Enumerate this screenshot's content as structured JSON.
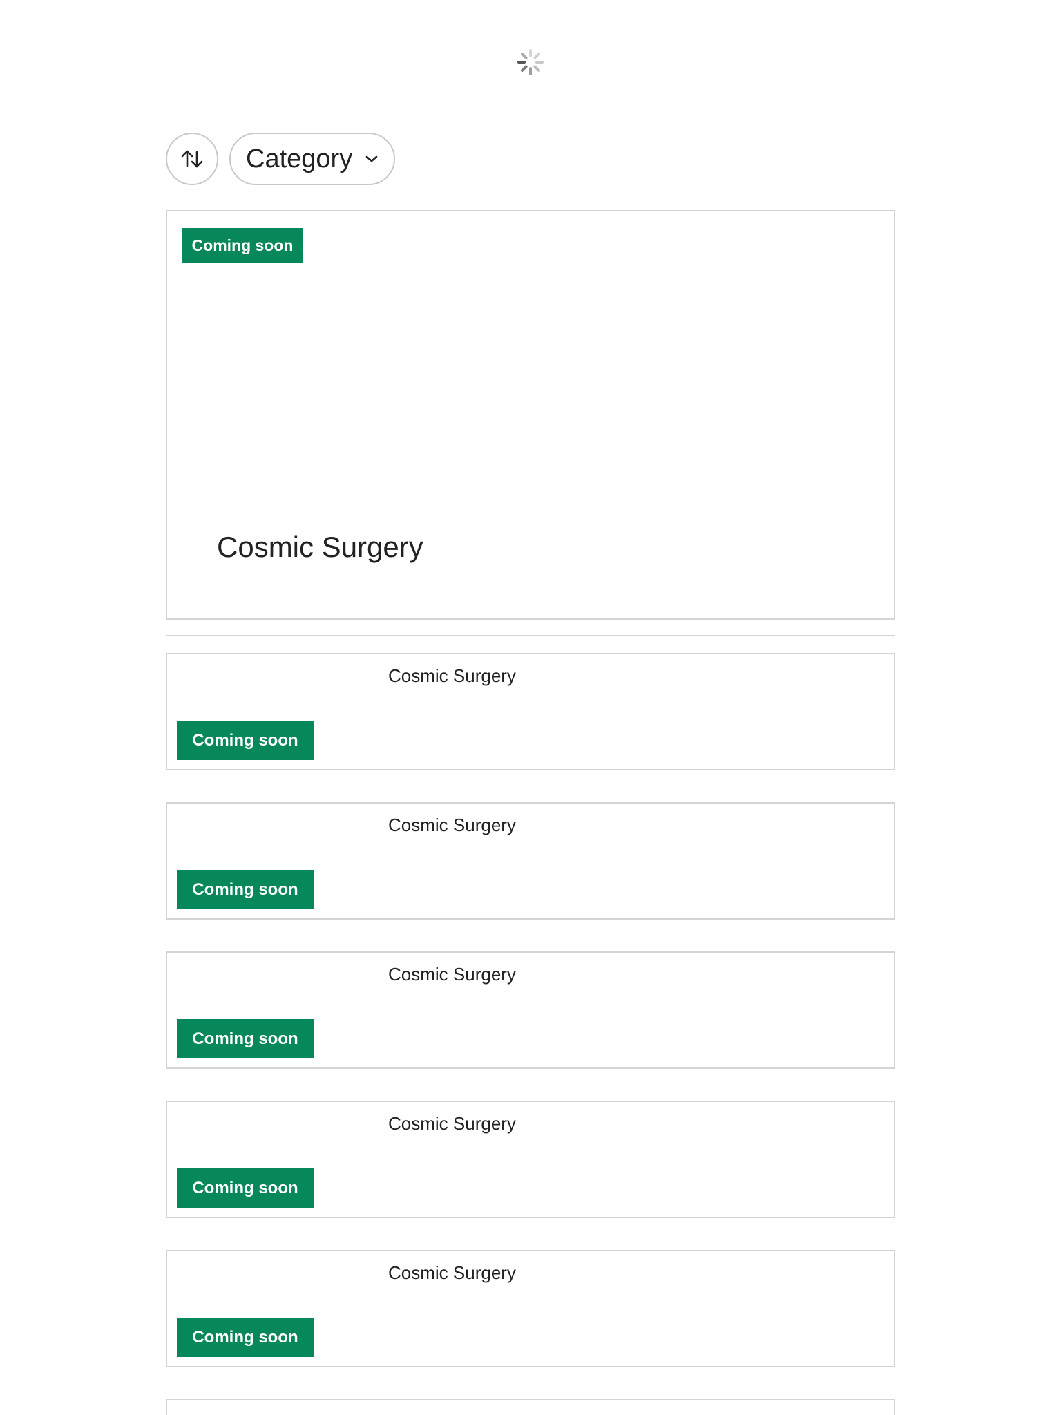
{
  "toolbar": {
    "sort_icon": "sort-arrows-icon",
    "category_label": "Category",
    "category_icon": "chevron-down-icon"
  },
  "featured": {
    "badge": "Coming soon",
    "title": "Cosmic Surgery"
  },
  "list": {
    "items": [
      {
        "title": "Cosmic Surgery",
        "badge": "Coming soon"
      },
      {
        "title": "Cosmic Surgery",
        "badge": "Coming soon"
      },
      {
        "title": "Cosmic Surgery",
        "badge": "Coming soon"
      },
      {
        "title": "Cosmic Surgery",
        "badge": "Coming soon"
      },
      {
        "title": "Cosmic Surgery",
        "badge": "Coming soon"
      }
    ]
  },
  "colors": {
    "badge_bg": "#06885a",
    "badge_text": "#ffffff",
    "border": "#d4d4d4"
  }
}
